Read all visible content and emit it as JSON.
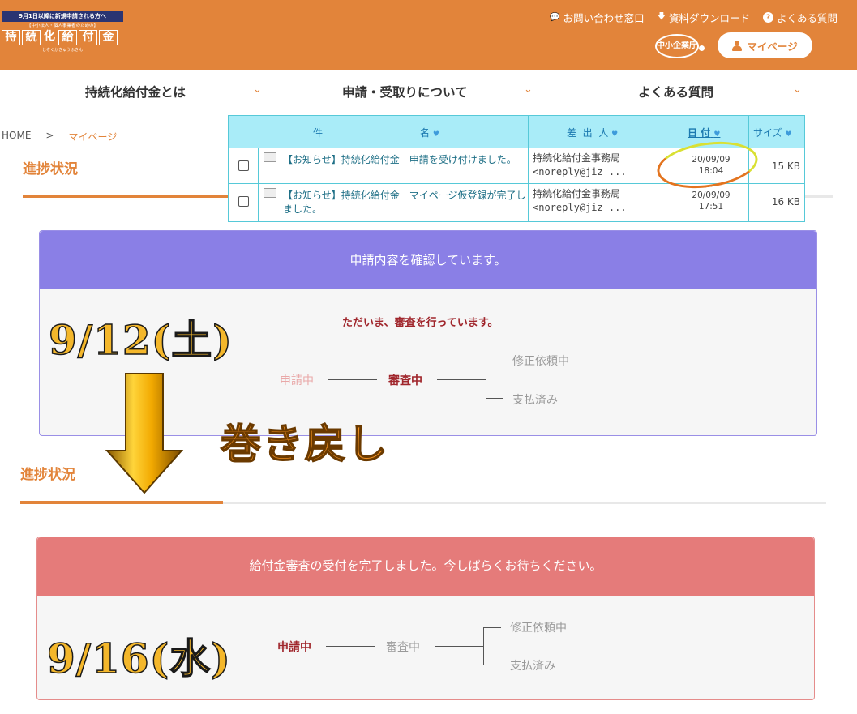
{
  "header": {
    "logo": {
      "top_banner": "9月1日以降に新規申請される方へ",
      "subtitle": "【中小法人・個人事業者のための】",
      "chars": [
        "持",
        "続",
        "化",
        "給",
        "付",
        "金"
      ],
      "ruby": "じぞくかきゅうふきん"
    },
    "links": {
      "contact": "お問い合わせ窓口",
      "download": "資料ダウンロード",
      "faq": "よくある質問"
    },
    "agency_logo": "中小企業庁",
    "mypage_button": "マイページ"
  },
  "nav": {
    "items": [
      "持続化給付金とは",
      "申請・受取りについて",
      "よくある質問"
    ]
  },
  "breadcrumb": {
    "home": "HOME",
    "sep": ">",
    "current": "マイページ"
  },
  "mail": {
    "columns": {
      "subject_a": "件",
      "subject_b": "名",
      "sender_a": "差",
      "sender_b": "出",
      "sender_c": "人",
      "date": "日 付",
      "size": "サイズ"
    },
    "rows": [
      {
        "subject": "【お知らせ】持続化給付金　申請を受け付けました。",
        "sender_1": "持続化給付金事務局",
        "sender_2": "<noreply@jiz ...",
        "date_1": "20/09/09",
        "date_2": "18:04",
        "size": "15 KB"
      },
      {
        "subject": "【お知らせ】持続化給付金　マイページ仮登録が完了しました。",
        "sender_1": "持続化給付金事務局",
        "sender_2": "<noreply@jiz ...",
        "date_1": "20/09/09",
        "date_2": "17:51",
        "size": "16 KB"
      }
    ]
  },
  "progress_top": {
    "section_title": "進捗状況",
    "header": "申請内容を確認しています。",
    "message": "ただいま、審査を行っています。",
    "steps": {
      "applying": "申請中",
      "reviewing": "審査中",
      "revision": "修正依頼中",
      "paid": "支払済み"
    },
    "header_color": "#8A7FE6"
  },
  "progress_bottom": {
    "section_title": "進捗状況",
    "header": "給付金審査の受付を完了しました。今しばらくお待ちください。",
    "steps": {
      "applying": "申請中",
      "reviewing": "審査中",
      "revision": "修正依頼中",
      "paid": "支払済み"
    },
    "header_color": "#E57B7A"
  },
  "annotations": {
    "date_top": "9/12(土)",
    "date_bottom": "9/16(水)",
    "rollback": "巻き戻し"
  },
  "colors": {
    "brand": "#E2843A",
    "active_step": "#A0262C",
    "mail_header": "#A9ECF8"
  }
}
